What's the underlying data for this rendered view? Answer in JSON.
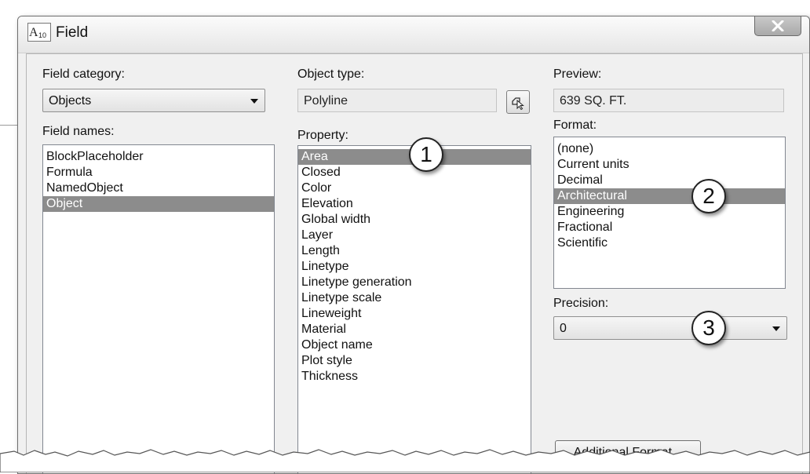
{
  "window": {
    "title": "Field",
    "app_icon": "autocad-field-icon"
  },
  "field_category": {
    "label": "Field category:",
    "value": "Objects"
  },
  "field_names": {
    "label": "Field names:",
    "items": [
      "BlockPlaceholder",
      "Formula",
      "NamedObject",
      "Object"
    ],
    "selected": "Object"
  },
  "object_type": {
    "label": "Object type:",
    "value": "Polyline",
    "pick_icon": "select-object-icon"
  },
  "property": {
    "label": "Property:",
    "items": [
      "Area",
      "Closed",
      "Color",
      "Elevation",
      "Global width",
      "Layer",
      "Length",
      "Linetype",
      "Linetype generation",
      "Linetype scale",
      "Lineweight",
      "Material",
      "Object name",
      "Plot style",
      "Thickness"
    ],
    "selected": "Area"
  },
  "preview": {
    "label": "Preview:",
    "value": "639 SQ. FT."
  },
  "format": {
    "label": "Format:",
    "items": [
      "(none)",
      "Current units",
      "Decimal",
      "Architectural",
      "Engineering",
      "Fractional",
      "Scientific"
    ],
    "selected": "Architectural"
  },
  "precision": {
    "label": "Precision:",
    "value": "0"
  },
  "additional_format": {
    "label": "Additional Format..."
  },
  "callouts": [
    "1",
    "2",
    "3"
  ],
  "colors": {
    "selection": "#8c8c8c",
    "dialog_bg": "#f0f0f0",
    "list_bg": "#ffffff"
  }
}
